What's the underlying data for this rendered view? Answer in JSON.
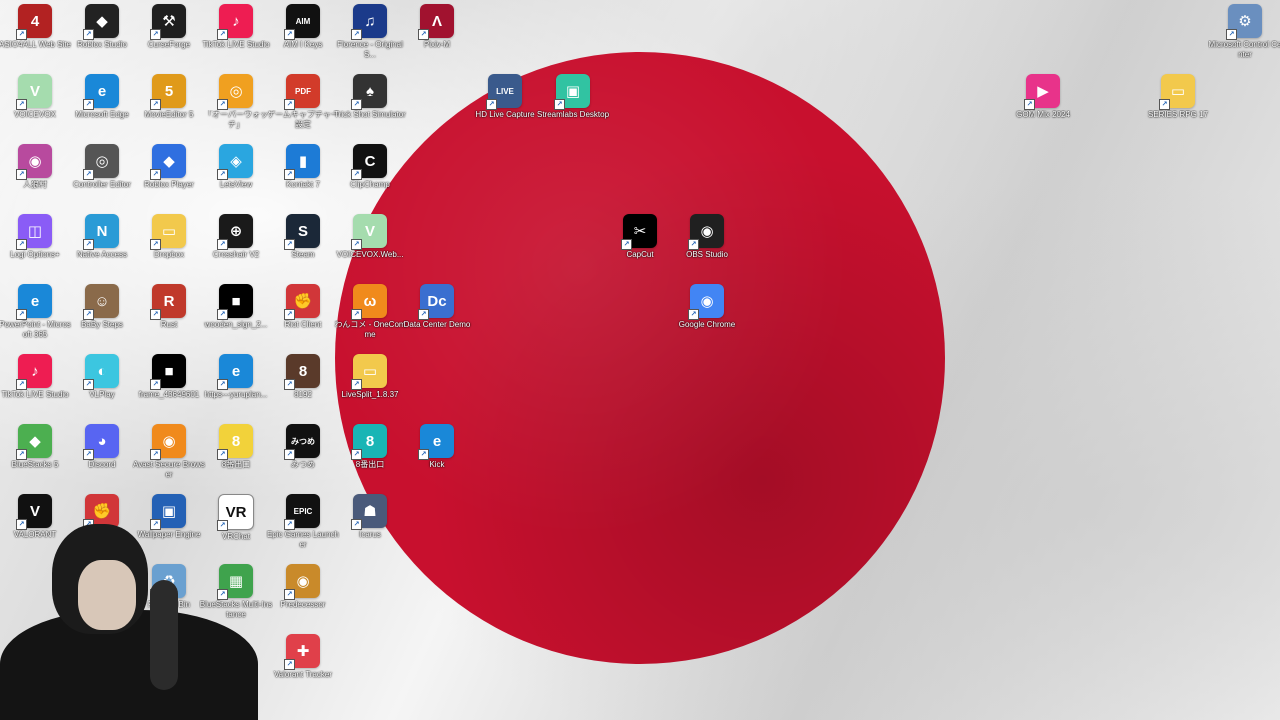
{
  "desktop": {
    "wallpaper": {
      "background": "#eeeeee",
      "circle": "#c8102e"
    },
    "icons": [
      {
        "label": "ASIO4ALL Web Site",
        "glyph": "4",
        "color": "#b22222",
        "icon": "asio4all-icon"
      },
      {
        "label": "Roblox Studio",
        "glyph": "◆",
        "color": "#222222",
        "icon": "roblox-studio-icon"
      },
      {
        "label": "CurseForge",
        "glyph": "⚒",
        "color": "#1f1f1f",
        "icon": "curseforge-icon"
      },
      {
        "label": "TikTok LIVE Studio",
        "glyph": "♪",
        "color": "#ee1d52",
        "icon": "tiktok-live-studio-icon"
      },
      {
        "label": "AIM I Keys",
        "glyph": "AIM",
        "color": "#111111",
        "icon": "aim-keys-icon"
      },
      {
        "label": "Florence - Original S...",
        "glyph": "♫",
        "color": "#1b3a8a",
        "icon": "florence-icon"
      },
      {
        "label": "Pixiv-M",
        "glyph": "Λ",
        "color": "#a1122f",
        "icon": "pixiv-icon"
      },
      {
        "label": "Microsoft Control Center",
        "glyph": "⚙",
        "color": "#6a8fbf",
        "icon": "control-center-icon"
      },
      {
        "label": "VOICEVOX",
        "glyph": "V",
        "color": "#a5dcae",
        "icon": "voicevox-icon"
      },
      {
        "label": "Microsoft Edge",
        "glyph": "e",
        "color": "#1a88d8",
        "icon": "edge-icon"
      },
      {
        "label": "MovieEditor 5",
        "glyph": "5",
        "color": "#e09a1a",
        "icon": "movie-editor-icon"
      },
      {
        "label": "「オーバーウォッチ」",
        "glyph": "◎",
        "color": "#f0a020",
        "icon": "overwatch-icon"
      },
      {
        "label": "ゲームキャプチャー設定",
        "glyph": "PDF",
        "color": "#d23b2a",
        "icon": "pdf-icon"
      },
      {
        "label": "Trick Shot Simulator",
        "glyph": "♠",
        "color": "#333333",
        "icon": "trick-shot-icon"
      },
      {
        "label": "HD Live Capture",
        "glyph": "LIVE",
        "color": "#3a5a8c",
        "icon": "hd-live-capture-icon"
      },
      {
        "label": "Streamlabs Desktop",
        "glyph": "▣",
        "color": "#31c3a2",
        "icon": "streamlabs-icon"
      },
      {
        "label": "GOM Mix 2024",
        "glyph": "▶",
        "color": "#e8338a",
        "icon": "gom-mix-icon"
      },
      {
        "label": "SERIES RPG 17",
        "glyph": "▭",
        "color": "#f2c94c",
        "icon": "folder-icon"
      },
      {
        "label": "人狼村",
        "glyph": "◉",
        "color": "#b84a9e",
        "icon": "werewolf-icon"
      },
      {
        "label": "Controller Editor",
        "glyph": "◎",
        "color": "#555555",
        "icon": "controller-editor-icon"
      },
      {
        "label": "Roblox Player",
        "glyph": "◆",
        "color": "#2f6fe0",
        "icon": "roblox-player-icon"
      },
      {
        "label": "LetsView",
        "glyph": "◈",
        "color": "#2aa6e0",
        "icon": "letsview-icon"
      },
      {
        "label": "Kontakt 7",
        "glyph": "▮",
        "color": "#1d7bd6",
        "icon": "kontakt-icon"
      },
      {
        "label": "ClipChamp",
        "glyph": "C",
        "color": "#111111",
        "icon": "clipchamp-icon"
      },
      {
        "label": "Logi Options+",
        "glyph": "◫",
        "color": "#8a5cf6",
        "icon": "logi-options-icon"
      },
      {
        "label": "Native Access",
        "glyph": "N",
        "color": "#2a9bd6",
        "icon": "native-access-icon"
      },
      {
        "label": "Dropbox",
        "glyph": "▭",
        "color": "#f2c94c",
        "icon": "dropbox-folder-icon"
      },
      {
        "label": "Crosshair V2",
        "glyph": "⊕",
        "color": "#1a1a1a",
        "icon": "crosshair-icon"
      },
      {
        "label": "Steam",
        "glyph": "S",
        "color": "#1b2838",
        "icon": "steam-icon"
      },
      {
        "label": "VOICEVOX.Web...",
        "glyph": "V",
        "color": "#a5dcae",
        "icon": "voicevox-web-icon"
      },
      {
        "label": "CapCut",
        "glyph": "✂",
        "color": "#000000",
        "icon": "capcut-icon"
      },
      {
        "label": "OBS Studio",
        "glyph": "◉",
        "color": "#202020",
        "icon": "obs-studio-icon"
      },
      {
        "label": "PowerPoint - Microsoft 365",
        "glyph": "e",
        "color": "#1a88d8",
        "icon": "powerpoint-icon"
      },
      {
        "label": "BaBy Steps",
        "glyph": "☺",
        "color": "#8a6a4a",
        "icon": "baby-steps-icon"
      },
      {
        "label": "Rust",
        "glyph": "R",
        "color": "#c0392b",
        "icon": "rust-icon"
      },
      {
        "label": "wooden_sign_2...",
        "glyph": "■",
        "color": "#000000",
        "icon": "wooden-sign-icon"
      },
      {
        "label": "Riot Client",
        "glyph": "✊",
        "color": "#d13639",
        "icon": "riot-client-icon"
      },
      {
        "label": "わんコメ - OneComme",
        "glyph": "ω",
        "color": "#f08a1c",
        "icon": "onecomme-icon"
      },
      {
        "label": "Data Center Demo",
        "glyph": "Dc",
        "color": "#3a6fd0",
        "icon": "data-center-icon"
      },
      {
        "label": "Google Chrome",
        "glyph": "◉",
        "color": "#4285f4",
        "icon": "chrome-icon"
      },
      {
        "label": "TikTok LIVE Studio",
        "glyph": "♪",
        "color": "#ee1d52",
        "icon": "tiktok-live-studio-2-icon"
      },
      {
        "label": "VLPlay",
        "glyph": "◐",
        "color": "#3cc6e0",
        "icon": "vlplay-icon"
      },
      {
        "label": "frame_43649601",
        "glyph": "■",
        "color": "#000000",
        "icon": "frame-icon"
      },
      {
        "label": "https---yuruplan...",
        "glyph": "e",
        "color": "#1a88d8",
        "icon": "edge-link-icon"
      },
      {
        "label": "8192",
        "glyph": "8",
        "color": "#5a3a2a",
        "icon": "game-8192-icon"
      },
      {
        "label": "LiveSplit_1.8.37",
        "glyph": "▭",
        "color": "#f2c94c",
        "icon": "livesplit-folder-icon"
      },
      {
        "label": "BlueStacks 5",
        "glyph": "◆",
        "color": "#4caf50",
        "icon": "bluestacks-icon"
      },
      {
        "label": "Discord",
        "glyph": "◕",
        "color": "#5865f2",
        "icon": "discord-icon"
      },
      {
        "label": "Avast Secure Browser",
        "glyph": "◉",
        "color": "#f08a1c",
        "icon": "avast-browser-icon"
      },
      {
        "label": "8番出口",
        "glyph": "8",
        "color": "#f2d23a",
        "icon": "exit-8-icon"
      },
      {
        "label": "みつめ",
        "glyph": "みつめ",
        "color": "#111111",
        "icon": "mitsume-icon"
      },
      {
        "label": "8番出口",
        "glyph": "8",
        "color": "#19b5b5",
        "icon": "exit-8-2-icon"
      },
      {
        "label": "Kick",
        "glyph": "e",
        "color": "#1a88d8",
        "icon": "kick-icon"
      },
      {
        "label": "VALORANT",
        "glyph": "V",
        "color": "#111111",
        "icon": "valorant-icon"
      },
      {
        "label": "Riot Client",
        "glyph": "✊",
        "color": "#d13639",
        "icon": "riot-client-2-icon"
      },
      {
        "label": "Wallpaper Engine",
        "glyph": "▣",
        "color": "#2461b5",
        "icon": "wallpaper-engine-icon"
      },
      {
        "label": "VRChat",
        "glyph": "VR",
        "color": "#ffffff",
        "icon": "vrchat-icon"
      },
      {
        "label": "Epic Games Launcher",
        "glyph": "EPIC",
        "color": "#111111",
        "icon": "epic-games-icon"
      },
      {
        "label": "Icarus",
        "glyph": "☗",
        "color": "#4a5a7a",
        "icon": "icarus-icon"
      },
      {
        "label": "Recycle Bin",
        "glyph": "♻",
        "color": "#6aa0d0",
        "icon": "recycle-bin-icon"
      },
      {
        "label": "BlueStacks Multi-Instance",
        "glyph": "▦",
        "color": "#3fa34d",
        "icon": "bluestacks-multi-icon"
      },
      {
        "label": "Predecessor",
        "glyph": "◉",
        "color": "#c98a2a",
        "icon": "predecessor-icon"
      },
      {
        "label": "Valorant Tracker",
        "glyph": "✚",
        "color": "#e0404a",
        "icon": "valorant-tracker-icon"
      }
    ]
  }
}
